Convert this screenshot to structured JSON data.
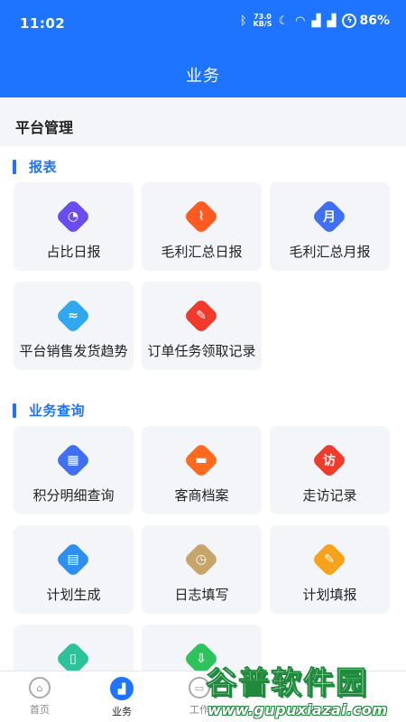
{
  "status_bar": {
    "time": "11:02",
    "net_speed_value": "73.0",
    "net_speed_unit": "KB/S",
    "battery": "86%"
  },
  "header": {
    "title": "业务"
  },
  "platform": {
    "label": "平台管理"
  },
  "sections": {
    "reports": {
      "title": "报表",
      "items": [
        {
          "label": "占比日报",
          "icon": "pie-chart-icon",
          "color": "#6a4df0",
          "glyph": "◔"
        },
        {
          "label": "毛利汇总日报",
          "icon": "line-chart-icon",
          "color": "#ff5a1f",
          "glyph": "⌇"
        },
        {
          "label": "毛利汇总月报",
          "icon": "month-calendar-icon",
          "color": "#3f6ff2",
          "glyph": "月"
        },
        {
          "label": "平台销售发货趋势",
          "icon": "sales-trend-icon",
          "color": "#2fa8f0",
          "glyph": "≈"
        },
        {
          "label": "订单任务领取记录",
          "icon": "order-task-icon",
          "color": "#f03a2c",
          "glyph": "✎"
        }
      ]
    },
    "query": {
      "title": "业务查询",
      "items": [
        {
          "label": "积分明细查询",
          "icon": "points-query-icon",
          "color": "#3f6ff2",
          "glyph": "▦"
        },
        {
          "label": "客商档案",
          "icon": "folder-icon",
          "color": "#ff6a1f",
          "glyph": "▬"
        },
        {
          "label": "走访记录",
          "icon": "visit-record-icon",
          "color": "#f03a2c",
          "glyph": "访"
        },
        {
          "label": "计划生成",
          "icon": "printer-icon",
          "color": "#2f8ff0",
          "glyph": "▤"
        },
        {
          "label": "日志填写",
          "icon": "log-clipboard-icon",
          "color": "#c7a46a",
          "glyph": "◷"
        },
        {
          "label": "计划填报",
          "icon": "plan-edit-icon",
          "color": "#f7a21a",
          "glyph": "✎"
        },
        {
          "label": "",
          "icon": "book-icon",
          "color": "#2ec29a",
          "glyph": "▯"
        },
        {
          "label": "",
          "icon": "upload-doc-icon",
          "color": "#2ec25a",
          "glyph": "⇩"
        }
      ]
    }
  },
  "tabbar": {
    "items": [
      {
        "label": "首页",
        "glyph": "⌂"
      },
      {
        "label": "业务",
        "glyph": "▟"
      },
      {
        "label": "工作",
        "glyph": "▭"
      }
    ]
  },
  "watermark": {
    "title": "谷普软件园",
    "url": "www.gupuxiazai.com"
  }
}
